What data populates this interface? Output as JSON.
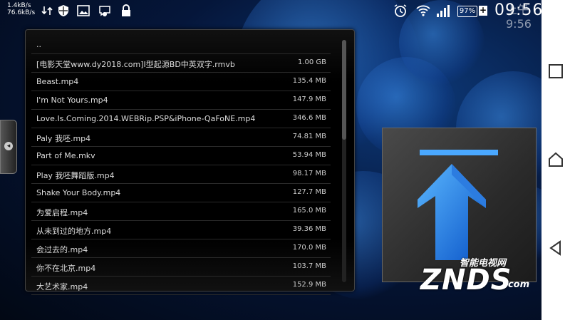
{
  "status_bar": {
    "speed_line1": "1.4kB/s",
    "speed_line2": "76.6kB/s",
    "time": "09:56",
    "ghost_time": "上午9:56",
    "battery_percent": "97%",
    "charging_symbol": "+",
    "icons": [
      "usb-icon",
      "download-arrows-icon",
      "shield-icon",
      "image-icon",
      "chat-icon",
      "lock-icon",
      "alarm-icon",
      "wifi-icon",
      "signal-icon",
      "battery-icon"
    ]
  },
  "file_list": {
    "parent": "..",
    "files": [
      {
        "name": "[电影天堂www.dy2018.com]I型起源BD中英双字.rmvb",
        "size": "1.00 GB"
      },
      {
        "name": "Beast.mp4",
        "size": "135.4 MB"
      },
      {
        "name": "I'm Not Yours.mp4",
        "size": "147.9 MB"
      },
      {
        "name": "Love.Is.Coming.2014.WEBRip.PSP&iPhone-QaFoNE.mp4",
        "size": "346.6 MB"
      },
      {
        "name": "Paly 我呸.mp4",
        "size": "74.81 MB"
      },
      {
        "name": "Part of Me.mkv",
        "size": "53.94 MB"
      },
      {
        "name": "Play 我呸舞蹈版.mp4",
        "size": "98.17 MB"
      },
      {
        "name": "Shake Your Body.mp4",
        "size": "127.7 MB"
      },
      {
        "name": "为爱启程.mp4",
        "size": "165.0 MB"
      },
      {
        "name": "从未到过的地方.mp4",
        "size": "39.36 MB"
      },
      {
        "name": "会过去的.mp4",
        "size": "170.0 MB"
      },
      {
        "name": "你不在北京.mp4",
        "size": "103.7 MB"
      },
      {
        "name": "大艺术家.mp4",
        "size": "152.9 MB"
      }
    ]
  },
  "side_tab_symbol": "◂",
  "up_button": {
    "icon": "up-arrow-icon",
    "color": "#1e90ff"
  },
  "nav_bar": {
    "icons": [
      "recent-apps-icon",
      "home-icon",
      "back-icon"
    ]
  },
  "watermark": {
    "cn": "智能电视网",
    "en": "ZNDS",
    "suffix": ".com"
  }
}
